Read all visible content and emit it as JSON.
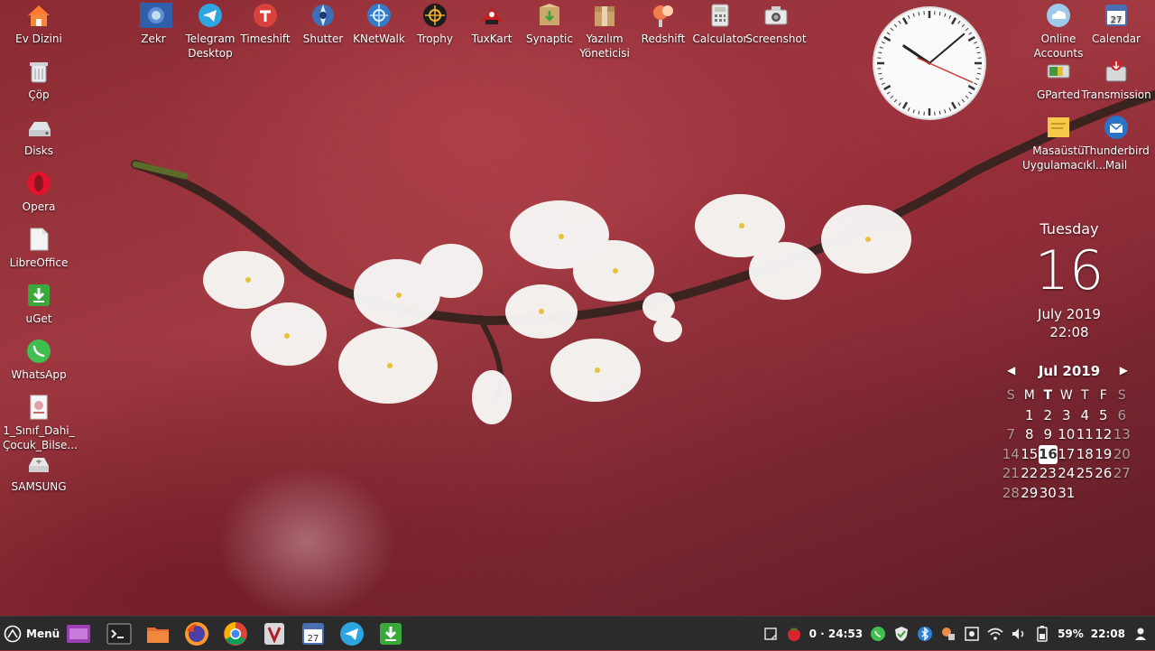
{
  "desktop": {
    "left_icons": [
      {
        "label": "Ev Dizini",
        "icon": "home-folder-icon"
      },
      {
        "label": "Çöp",
        "icon": "trash-icon"
      },
      {
        "label": "Disks",
        "icon": "disks-icon"
      },
      {
        "label": "Opera",
        "icon": "opera-icon"
      },
      {
        "label": "LibreOffice",
        "icon": "document-icon"
      },
      {
        "label": "uGet",
        "icon": "uget-icon"
      },
      {
        "label": "WhatsApp",
        "icon": "whatsapp-icon"
      },
      {
        "label": "1_Sınıf_Dahi_ Çocuk_Bilse...",
        "icon": "pdf-file-icon"
      },
      {
        "label": "SAMSUNG",
        "icon": "drive-icon"
      }
    ],
    "top_icons": [
      {
        "label": "Zekr",
        "icon": "zekr-icon"
      },
      {
        "label": "Telegram Desktop",
        "icon": "telegram-icon"
      },
      {
        "label": "Timeshift",
        "icon": "timeshift-icon"
      },
      {
        "label": "Shutter",
        "icon": "shutter-icon"
      },
      {
        "label": "KNetWalk",
        "icon": "knetwalk-icon"
      },
      {
        "label": "Trophy",
        "icon": "trophy-icon"
      },
      {
        "label": "TuxKart",
        "icon": "tuxkart-icon"
      },
      {
        "label": "Synaptic",
        "icon": "synaptic-icon"
      },
      {
        "label": "Yazılım Yöneticisi",
        "icon": "software-manager-icon"
      },
      {
        "label": "Redshift",
        "icon": "redshift-icon"
      },
      {
        "label": "Calculator",
        "icon": "calculator-icon"
      },
      {
        "label": "Screenshot",
        "icon": "camera-icon"
      }
    ],
    "right_icons": [
      {
        "label": "Online Accounts",
        "icon": "cloud-icon"
      },
      {
        "label": "Calendar",
        "icon": "calendar-icon"
      },
      {
        "label": "GParted",
        "icon": "gparted-icon"
      },
      {
        "label": "Transmission",
        "icon": "transmission-icon"
      },
      {
        "label": "Masaüstü Uygulamacıkl...",
        "icon": "sticky-note-icon"
      },
      {
        "label": "Thunderbird Mail",
        "icon": "thunderbird-icon"
      }
    ]
  },
  "clock": {
    "hour": 22,
    "minute": 8,
    "second": 19
  },
  "date_widget": {
    "day_name": "Tuesday",
    "day_number": "16",
    "month_year": "July 2019",
    "time": "22:08"
  },
  "calendar": {
    "title": "Jul 2019",
    "prev_glyph": "◀",
    "next_glyph": "▶",
    "weekdays": [
      "S",
      "M",
      "T",
      "W",
      "T",
      "F",
      "S"
    ],
    "today_weekday_index": 2,
    "weeks": [
      [
        "",
        "1",
        "2",
        "3",
        "4",
        "5",
        "6"
      ],
      [
        "7",
        "8",
        "9",
        "10",
        "11",
        "12",
        "13"
      ],
      [
        "14",
        "15",
        "16",
        "17",
        "18",
        "19",
        "20"
      ],
      [
        "21",
        "22",
        "23",
        "24",
        "25",
        "26",
        "27"
      ],
      [
        "28",
        "29",
        "30",
        "31",
        "",
        "",
        ""
      ]
    ],
    "today": "16"
  },
  "taskbar": {
    "menu_label": "Menü",
    "launchers": [
      {
        "icon": "workspace-switcher-icon"
      },
      {
        "icon": "terminal-icon"
      },
      {
        "icon": "files-icon"
      },
      {
        "icon": "firefox-icon"
      },
      {
        "icon": "chrome-icon"
      },
      {
        "icon": "vivaldi-icon"
      },
      {
        "icon": "calendar-icon"
      },
      {
        "icon": "telegram-icon"
      },
      {
        "icon": "uget-icon"
      }
    ],
    "tray": {
      "pomodoro": "0 · 24:53",
      "battery": "59%",
      "time": "22:08"
    }
  },
  "colors": {
    "taskbar": "#2b2b2b",
    "wallpaper": "#8a2a33",
    "today_bg": "#ffffff"
  }
}
